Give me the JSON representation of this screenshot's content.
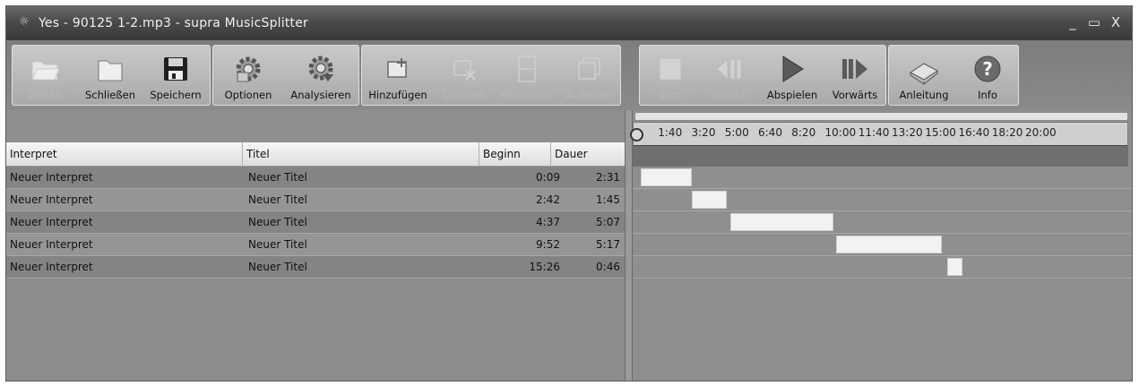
{
  "window": {
    "title": "Yes - 90125 1-2.mp3 - supra MusicSplitter",
    "controls": [
      "_",
      "▭",
      "X"
    ]
  },
  "toolbar": {
    "groups": [
      [
        {
          "label": "Öffnen",
          "icon": "folder-open-icon",
          "enabled": false
        },
        {
          "label": "Schließen",
          "icon": "folder-icon",
          "enabled": true
        },
        {
          "label": "Speichern",
          "icon": "floppy-disk-icon",
          "enabled": true
        }
      ],
      [
        {
          "label": "Optionen",
          "icon": "gear-icon",
          "enabled": true
        },
        {
          "label": "Analysieren",
          "icon": "gear-analyze-icon",
          "enabled": true
        }
      ],
      [
        {
          "label": "Hinzufügen",
          "icon": "add-segment-icon",
          "enabled": true
        },
        {
          "label": "Löschen",
          "icon": "delete-segment-icon",
          "enabled": false
        },
        {
          "label": "Verbinden",
          "icon": "merge-icon",
          "enabled": false
        },
        {
          "label": "Aufteilen",
          "icon": "split-icon",
          "enabled": false
        }
      ],
      [
        {
          "label": "Stop",
          "icon": "stop-icon",
          "enabled": false
        },
        {
          "label": "Zurück",
          "icon": "rewind-icon",
          "enabled": false
        },
        {
          "label": "Abspielen",
          "icon": "play-icon",
          "enabled": true
        },
        {
          "label": "Vorwärts",
          "icon": "forward-icon",
          "enabled": true
        }
      ],
      [
        {
          "label": "Anleitung",
          "icon": "book-icon",
          "enabled": true
        },
        {
          "label": "Info",
          "icon": "help-icon",
          "enabled": true
        }
      ]
    ]
  },
  "table": {
    "headers": {
      "interpret": "Interpret",
      "titel": "Titel",
      "beginn": "Beginn",
      "dauer": "Dauer"
    },
    "rows": [
      {
        "interpret": "Neuer Interpret",
        "titel": "Neuer Titel",
        "beginn": "0:09",
        "dauer": "2:31"
      },
      {
        "interpret": "Neuer Interpret",
        "titel": "Neuer Titel",
        "beginn": "2:42",
        "dauer": "1:45"
      },
      {
        "interpret": "Neuer Interpret",
        "titel": "Neuer Titel",
        "beginn": "4:37",
        "dauer": "5:07"
      },
      {
        "interpret": "Neuer Interpret",
        "titel": "Neuer Titel",
        "beginn": "9:52",
        "dauer": "5:17"
      },
      {
        "interpret": "Neuer Interpret",
        "titel": "Neuer Titel",
        "beginn": "15:26",
        "dauer": "0:46"
      }
    ]
  },
  "timeline": {
    "tick_labels": [
      "1:40",
      "3:20",
      "5:00",
      "6:40",
      "8:20",
      "10:00",
      "11:40",
      "13:20",
      "15:00",
      "16:40",
      "18:20",
      "20:00"
    ]
  }
}
